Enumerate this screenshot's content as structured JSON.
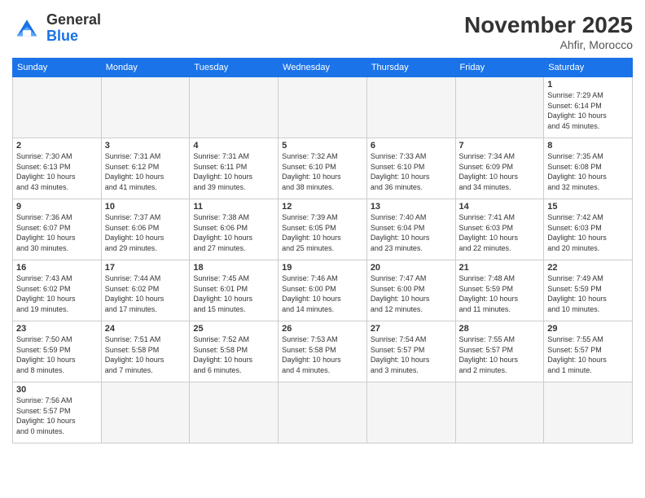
{
  "logo": {
    "line1": "General",
    "line2": "Blue"
  },
  "header": {
    "title": "November 2025",
    "subtitle": "Ahfir, Morocco"
  },
  "weekdays": [
    "Sunday",
    "Monday",
    "Tuesday",
    "Wednesday",
    "Thursday",
    "Friday",
    "Saturday"
  ],
  "weeks": [
    [
      {
        "day": null,
        "info": null
      },
      {
        "day": null,
        "info": null
      },
      {
        "day": null,
        "info": null
      },
      {
        "day": null,
        "info": null
      },
      {
        "day": null,
        "info": null
      },
      {
        "day": null,
        "info": null
      },
      {
        "day": "1",
        "info": "Sunrise: 7:29 AM\nSunset: 6:14 PM\nDaylight: 10 hours\nand 45 minutes."
      }
    ],
    [
      {
        "day": "2",
        "info": "Sunrise: 7:30 AM\nSunset: 6:13 PM\nDaylight: 10 hours\nand 43 minutes."
      },
      {
        "day": "3",
        "info": "Sunrise: 7:31 AM\nSunset: 6:12 PM\nDaylight: 10 hours\nand 41 minutes."
      },
      {
        "day": "4",
        "info": "Sunrise: 7:31 AM\nSunset: 6:11 PM\nDaylight: 10 hours\nand 39 minutes."
      },
      {
        "day": "5",
        "info": "Sunrise: 7:32 AM\nSunset: 6:10 PM\nDaylight: 10 hours\nand 38 minutes."
      },
      {
        "day": "6",
        "info": "Sunrise: 7:33 AM\nSunset: 6:10 PM\nDaylight: 10 hours\nand 36 minutes."
      },
      {
        "day": "7",
        "info": "Sunrise: 7:34 AM\nSunset: 6:09 PM\nDaylight: 10 hours\nand 34 minutes."
      },
      {
        "day": "8",
        "info": "Sunrise: 7:35 AM\nSunset: 6:08 PM\nDaylight: 10 hours\nand 32 minutes."
      }
    ],
    [
      {
        "day": "9",
        "info": "Sunrise: 7:36 AM\nSunset: 6:07 PM\nDaylight: 10 hours\nand 30 minutes."
      },
      {
        "day": "10",
        "info": "Sunrise: 7:37 AM\nSunset: 6:06 PM\nDaylight: 10 hours\nand 29 minutes."
      },
      {
        "day": "11",
        "info": "Sunrise: 7:38 AM\nSunset: 6:06 PM\nDaylight: 10 hours\nand 27 minutes."
      },
      {
        "day": "12",
        "info": "Sunrise: 7:39 AM\nSunset: 6:05 PM\nDaylight: 10 hours\nand 25 minutes."
      },
      {
        "day": "13",
        "info": "Sunrise: 7:40 AM\nSunset: 6:04 PM\nDaylight: 10 hours\nand 23 minutes."
      },
      {
        "day": "14",
        "info": "Sunrise: 7:41 AM\nSunset: 6:03 PM\nDaylight: 10 hours\nand 22 minutes."
      },
      {
        "day": "15",
        "info": "Sunrise: 7:42 AM\nSunset: 6:03 PM\nDaylight: 10 hours\nand 20 minutes."
      }
    ],
    [
      {
        "day": "16",
        "info": "Sunrise: 7:43 AM\nSunset: 6:02 PM\nDaylight: 10 hours\nand 19 minutes."
      },
      {
        "day": "17",
        "info": "Sunrise: 7:44 AM\nSunset: 6:02 PM\nDaylight: 10 hours\nand 17 minutes."
      },
      {
        "day": "18",
        "info": "Sunrise: 7:45 AM\nSunset: 6:01 PM\nDaylight: 10 hours\nand 15 minutes."
      },
      {
        "day": "19",
        "info": "Sunrise: 7:46 AM\nSunset: 6:00 PM\nDaylight: 10 hours\nand 14 minutes."
      },
      {
        "day": "20",
        "info": "Sunrise: 7:47 AM\nSunset: 6:00 PM\nDaylight: 10 hours\nand 12 minutes."
      },
      {
        "day": "21",
        "info": "Sunrise: 7:48 AM\nSunset: 5:59 PM\nDaylight: 10 hours\nand 11 minutes."
      },
      {
        "day": "22",
        "info": "Sunrise: 7:49 AM\nSunset: 5:59 PM\nDaylight: 10 hours\nand 10 minutes."
      }
    ],
    [
      {
        "day": "23",
        "info": "Sunrise: 7:50 AM\nSunset: 5:59 PM\nDaylight: 10 hours\nand 8 minutes."
      },
      {
        "day": "24",
        "info": "Sunrise: 7:51 AM\nSunset: 5:58 PM\nDaylight: 10 hours\nand 7 minutes."
      },
      {
        "day": "25",
        "info": "Sunrise: 7:52 AM\nSunset: 5:58 PM\nDaylight: 10 hours\nand 6 minutes."
      },
      {
        "day": "26",
        "info": "Sunrise: 7:53 AM\nSunset: 5:58 PM\nDaylight: 10 hours\nand 4 minutes."
      },
      {
        "day": "27",
        "info": "Sunrise: 7:54 AM\nSunset: 5:57 PM\nDaylight: 10 hours\nand 3 minutes."
      },
      {
        "day": "28",
        "info": "Sunrise: 7:55 AM\nSunset: 5:57 PM\nDaylight: 10 hours\nand 2 minutes."
      },
      {
        "day": "29",
        "info": "Sunrise: 7:55 AM\nSunset: 5:57 PM\nDaylight: 10 hours\nand 1 minute."
      }
    ],
    [
      {
        "day": "30",
        "info": "Sunrise: 7:56 AM\nSunset: 5:57 PM\nDaylight: 10 hours\nand 0 minutes."
      },
      {
        "day": null,
        "info": null
      },
      {
        "day": null,
        "info": null
      },
      {
        "day": null,
        "info": null
      },
      {
        "day": null,
        "info": null
      },
      {
        "day": null,
        "info": null
      },
      {
        "day": null,
        "info": null
      }
    ]
  ]
}
